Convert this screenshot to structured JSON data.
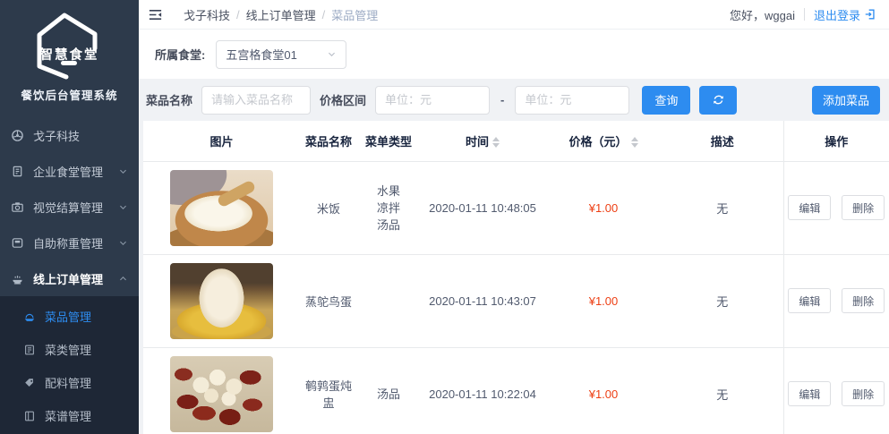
{
  "colors": {
    "primary": "#2d8cf0",
    "price_red": "#ed3f14",
    "sidebar_bg": "#2d3a4b",
    "submenu_bg": "#1e2736"
  },
  "brand": {
    "logo_title": "智慧食堂",
    "subtitle": "餐饮后台管理系统"
  },
  "sidebar": {
    "items": [
      {
        "label": "戈子科技",
        "icon": "dashboard-icon"
      },
      {
        "label": "企业食堂管理",
        "icon": "canteen-building-icon"
      },
      {
        "label": "视觉结算管理",
        "icon": "camera-icon"
      },
      {
        "label": "自助称重管理",
        "icon": "weighing-scale-icon"
      },
      {
        "label": "线上订单管理",
        "icon": "online-order-icon"
      }
    ],
    "submenu": [
      {
        "label": "菜品管理",
        "icon": "dish-icon",
        "active": true
      },
      {
        "label": "菜类管理",
        "icon": "dish-category-icon",
        "active": false
      },
      {
        "label": "配料管理",
        "icon": "ingredient-icon",
        "active": false
      },
      {
        "label": "菜谱管理",
        "icon": "recipe-icon",
        "active": false
      }
    ]
  },
  "topbar": {
    "breadcrumb": [
      "戈子科技",
      "线上订单管理",
      "菜品管理"
    ],
    "separator": "/",
    "greeting": "您好，wggai",
    "logout_label": "退出登录"
  },
  "canteen_bar": {
    "label": "所属食堂:",
    "selected_option": "五宫格食堂01"
  },
  "filter_bar": {
    "name_label": "菜品名称",
    "name_placeholder": "请输入菜品名称",
    "price_label": "价格区间",
    "price_min_placeholder": "单位：元",
    "price_max_placeholder": "单位：元",
    "range_separator": "-",
    "search_label": "查询",
    "add_label": "添加菜品"
  },
  "table": {
    "headers": {
      "image": "图片",
      "name": "菜品名称",
      "type": "菜单类型",
      "time": "时间",
      "price": "价格（元）",
      "desc": "描述",
      "actions": "操作"
    },
    "action_labels": {
      "edit": "编辑",
      "delete": "删除"
    },
    "rows": [
      {
        "image": "rice-bowl",
        "name": "米饭",
        "types": [
          "水果",
          "凉拌",
          "汤品"
        ],
        "time": "2020-01-11 10:48:05",
        "price": "¥1.00",
        "desc": "无"
      },
      {
        "image": "ostrich-egg",
        "name": "蒸鸵鸟蛋",
        "types": [],
        "time": "2020-01-11 10:43:07",
        "price": "¥1.00",
        "desc": "无"
      },
      {
        "image": "quail-egg-stew",
        "name": "鹌鹑蛋炖盅",
        "types": [
          "汤品"
        ],
        "time": "2020-01-11 10:22:04",
        "price": "¥1.00",
        "desc": "无"
      }
    ]
  }
}
